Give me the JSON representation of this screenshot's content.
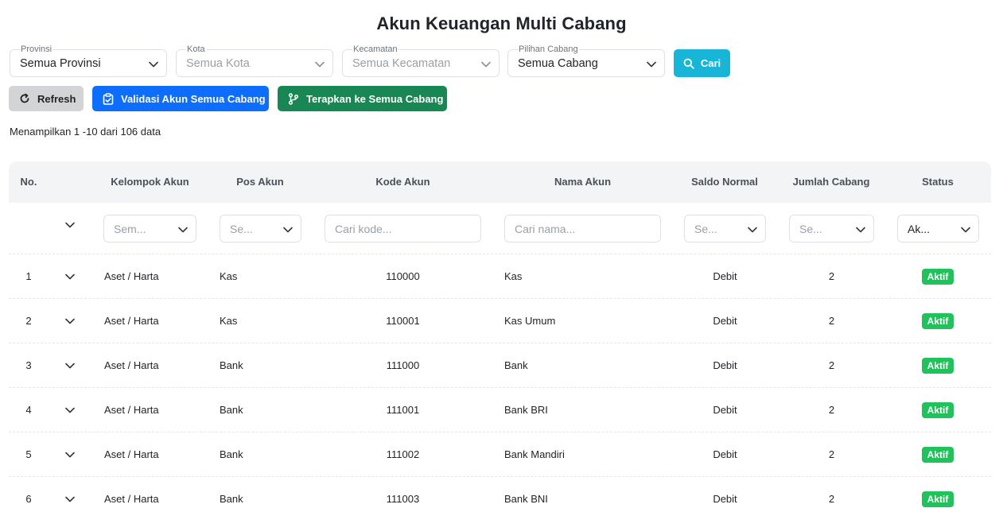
{
  "page": {
    "title": "Akun Keuangan Multi Cabang"
  },
  "filters": [
    {
      "label": "Provinsi",
      "value": "Semua Provinsi",
      "disabled": false
    },
    {
      "label": "Kota",
      "value": "Semua Kota",
      "disabled": true
    },
    {
      "label": "Kecamatan",
      "value": "Semua Kecamatan",
      "disabled": true
    },
    {
      "label": "Pilihan Cabang",
      "value": "Semua Cabang",
      "disabled": false
    }
  ],
  "search_button": {
    "label": "Cari",
    "icon": "search-icon"
  },
  "actions": {
    "refresh": "Refresh",
    "validasi": "Validasi Akun Semua Cabang",
    "terapkan": "Terapkan ke Semua Cabang"
  },
  "info": "Menampilkan 1 -10 dari 106 data",
  "colors": {
    "cari": "#17b6d8",
    "validasi": "#0d6efd",
    "terapkan": "#198754",
    "badge_aktif": "#21c15b",
    "refresh": "#d3d4d5"
  },
  "table": {
    "headers": {
      "no": "No.",
      "kelompok": "Kelompok Akun",
      "pos": "Pos Akun",
      "kode": "Kode Akun",
      "nama": "Nama Akun",
      "saldo": "Saldo Normal",
      "jumlah": "Jumlah Cabang",
      "status": "Status"
    },
    "column_filters": {
      "kelompok": "Sem...",
      "pos": "Se...",
      "kode_placeholder": "Cari kode...",
      "nama_placeholder": "Cari nama...",
      "saldo": "Se...",
      "jumlah": "Se...",
      "status": "Ak..."
    },
    "rows": [
      {
        "no": "1",
        "kelompok": "Aset / Harta",
        "pos": "Kas",
        "kode": "110000",
        "nama": "Kas",
        "saldo": "Debit",
        "jumlah": "2",
        "status": "Aktif"
      },
      {
        "no": "2",
        "kelompok": "Aset / Harta",
        "pos": "Kas",
        "kode": "110001",
        "nama": "Kas Umum",
        "saldo": "Debit",
        "jumlah": "2",
        "status": "Aktif"
      },
      {
        "no": "3",
        "kelompok": "Aset / Harta",
        "pos": "Bank",
        "kode": "111000",
        "nama": "Bank",
        "saldo": "Debit",
        "jumlah": "2",
        "status": "Aktif"
      },
      {
        "no": "4",
        "kelompok": "Aset / Harta",
        "pos": "Bank",
        "kode": "111001",
        "nama": "Bank BRI",
        "saldo": "Debit",
        "jumlah": "2",
        "status": "Aktif"
      },
      {
        "no": "5",
        "kelompok": "Aset / Harta",
        "pos": "Bank",
        "kode": "111002",
        "nama": "Bank Mandiri",
        "saldo": "Debit",
        "jumlah": "2",
        "status": "Aktif"
      },
      {
        "no": "6",
        "kelompok": "Aset / Harta",
        "pos": "Bank",
        "kode": "111003",
        "nama": "Bank BNI",
        "saldo": "Debit",
        "jumlah": "2",
        "status": "Aktif"
      }
    ]
  }
}
